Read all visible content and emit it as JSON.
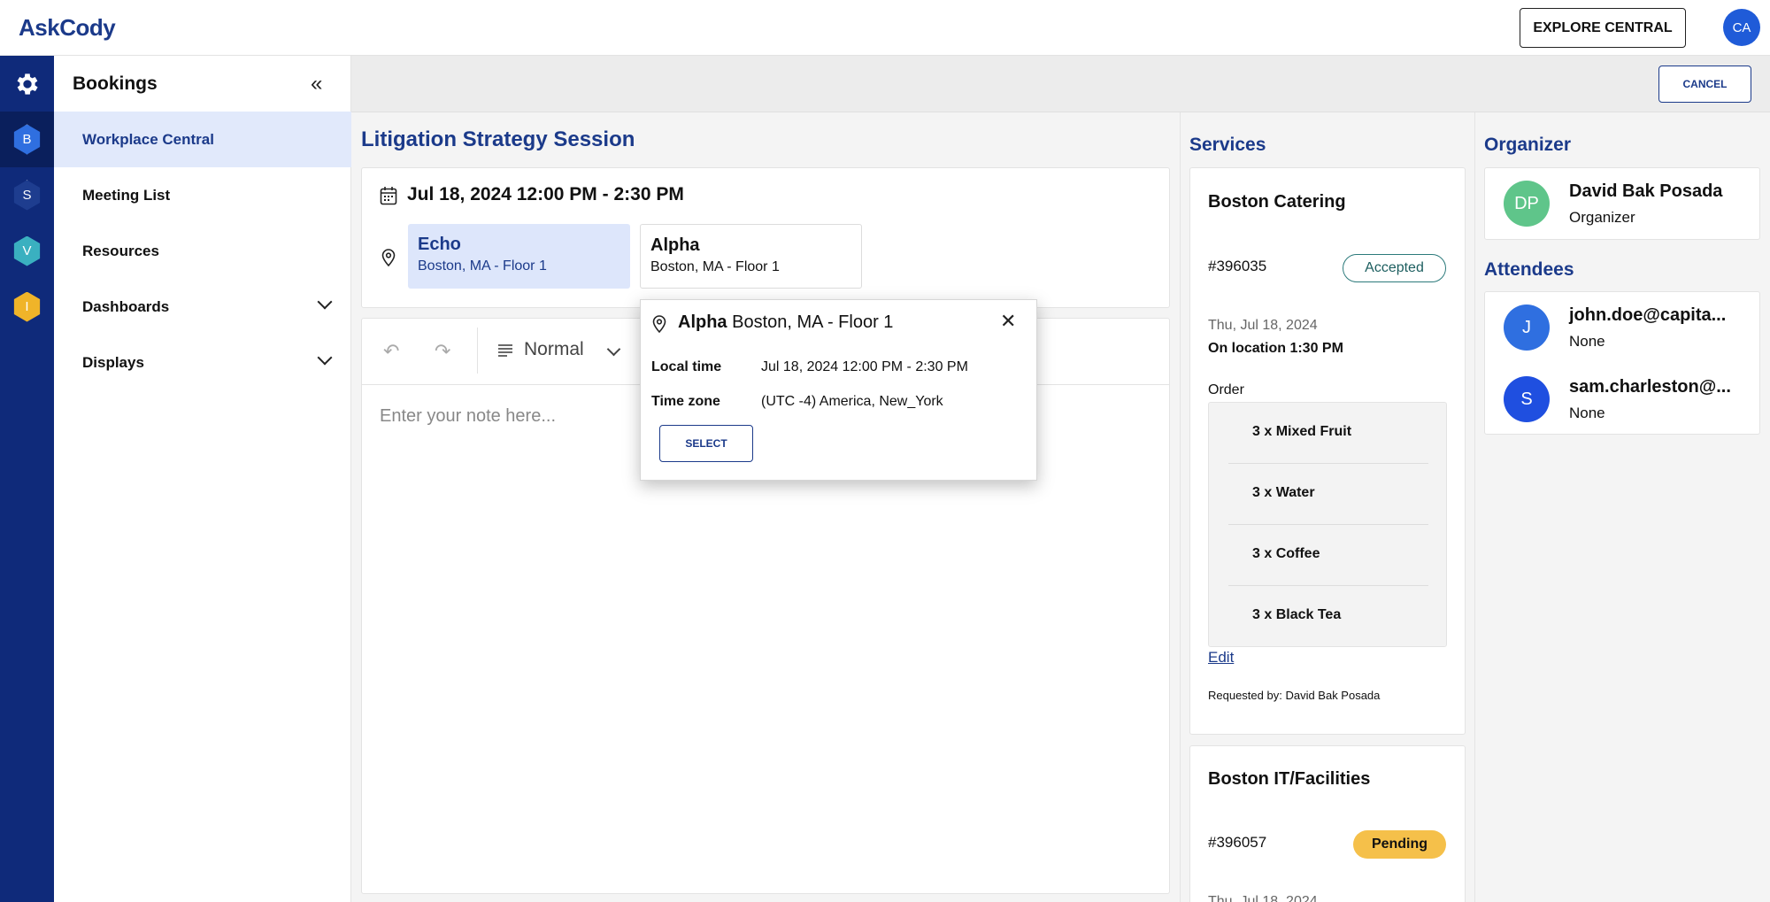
{
  "app": {
    "logo": "AskCody",
    "explore_label": "EXPLORE CENTRAL",
    "user_initials": "CA"
  },
  "rail": [
    {
      "icon": "gear-icon",
      "letter": ""
    },
    {
      "icon": "bookings-hex-icon",
      "letter": "B",
      "color": "#2f6fe0"
    },
    {
      "icon": "services-hex-icon",
      "letter": "S",
      "color": "#1e3d8f"
    },
    {
      "icon": "visitors-hex-icon",
      "letter": "V",
      "color": "#3ab0c0"
    },
    {
      "icon": "insights-hex-icon",
      "letter": "I",
      "color": "#f0b429"
    }
  ],
  "nav": {
    "title": "Bookings",
    "items": [
      {
        "label": "Workplace Central",
        "active": true
      },
      {
        "label": "Meeting List"
      },
      {
        "label": "Resources"
      },
      {
        "label": "Dashboards",
        "expandable": true
      },
      {
        "label": "Displays",
        "expandable": true
      }
    ]
  },
  "header": {
    "cancel_label": "CANCEL"
  },
  "meeting": {
    "title": "Litigation Strategy Session",
    "datetime": "Jul 18, 2024 12:00 PM - 2:30 PM",
    "rooms": [
      {
        "name": "Echo",
        "location": "Boston, MA - Floor 1",
        "selected": true
      },
      {
        "name": "Alpha",
        "location": "Boston, MA - Floor 1",
        "selected": false
      }
    ],
    "editor": {
      "format_label": "Normal",
      "placeholder": "Enter your note here..."
    }
  },
  "popup": {
    "room_name": "Alpha",
    "room_location": "Boston, MA - Floor 1",
    "local_time_label": "Local time",
    "local_time_value": "Jul 18, 2024 12:00 PM - 2:30 PM",
    "timezone_label": "Time zone",
    "timezone_value": "(UTC -4) America, New_York",
    "select_label": "SELECT"
  },
  "services": {
    "title": "Services",
    "items": [
      {
        "name": "Boston Catering",
        "id": "#396035",
        "status": "Accepted",
        "date": "Thu, Jul 18, 2024",
        "on_location": "On location 1:30 PM",
        "order_label": "Order",
        "order": [
          "3 x Mixed Fruit",
          "3 x Water",
          "3 x Coffee",
          "3 x Black Tea"
        ],
        "edit_label": "Edit",
        "requested_by": "Requested by: David Bak Posada"
      },
      {
        "name": "Boston IT/Facilities",
        "id": "#396057",
        "status": "Pending",
        "date": "Thu, Jul 18, 2024"
      }
    ]
  },
  "organizer": {
    "title": "Organizer",
    "initials": "DP",
    "name": "David Bak Posada",
    "role": "Organizer",
    "color": "#5fc58a"
  },
  "attendees": {
    "title": "Attendees",
    "items": [
      {
        "initial": "J",
        "name": "john.doe@capita...",
        "status": "None",
        "color": "#2f6fe0"
      },
      {
        "initial": "S",
        "name": "sam.charleston@...",
        "status": "None",
        "color": "#1f4fe0"
      }
    ]
  }
}
